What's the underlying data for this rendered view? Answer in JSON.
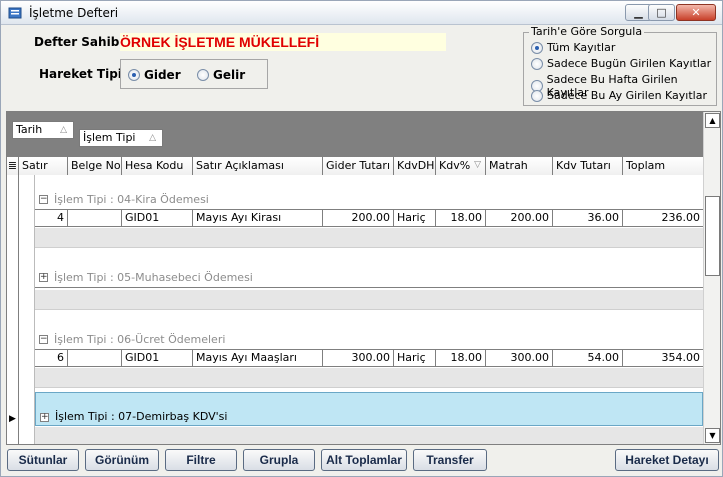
{
  "window": {
    "title": "İşletme Defteri"
  },
  "header": {
    "owner_label": "Defter Sahibi :",
    "owner_value": "ÖRNEK İŞLETME MÜKELLEFİ",
    "movement_label": "Hareket Tipi :",
    "movement_options": [
      "Gider",
      "Gelir"
    ],
    "movement_selected": "Gider"
  },
  "date_filter": {
    "legend": "Tarih'e Göre Sorgula",
    "options": [
      "Tüm Kayıtlar",
      "Sadece Bugün Girilen Kayıtlar",
      "Sadece Bu Hafta Girilen Kayıtlar",
      "Sadece Bu Ay Girilen Kayıtlar"
    ],
    "selected": "Tüm Kayıtlar"
  },
  "grid": {
    "group_chips": [
      "Tarih",
      "İşlem Tipi"
    ],
    "columns": [
      "Satır",
      "Belge No",
      "Hesa Kodu",
      "Satır Açıklaması",
      "Gider Tutarı",
      "KdvDH",
      "Kdv%",
      "Matrah",
      "Kdv Tutarı",
      "Toplam"
    ],
    "groups": [
      {
        "label": "İşlem Tipi : 04-Kira Ödemesi",
        "expanded": true,
        "rows": [
          [
            "4",
            "",
            "GID01",
            "Mayıs Ayı Kirası",
            "200.00",
            "Hariç",
            "18.00",
            "200.00",
            "36.00",
            "236.00"
          ]
        ]
      },
      {
        "label": "İşlem Tipi : 05-Muhasebeci Ödemesi",
        "expanded": false,
        "rows": []
      },
      {
        "label": "İşlem Tipi : 06-Ücret Ödemeleri",
        "expanded": true,
        "rows": [
          [
            "6",
            "",
            "GID01",
            "Mayıs Ayı Maaşları",
            "300.00",
            "Hariç",
            "18.00",
            "300.00",
            "54.00",
            "354.00"
          ]
        ]
      },
      {
        "label": "İşlem Tipi : 07-Demirbaş KDV'si",
        "expanded": false,
        "rows": []
      }
    ]
  },
  "buttons": [
    "Sütunlar",
    "Görünüm",
    "Filtre",
    "Grupla",
    "Alt Toplamlar",
    "Transfer",
    "Hareket Detayı"
  ]
}
